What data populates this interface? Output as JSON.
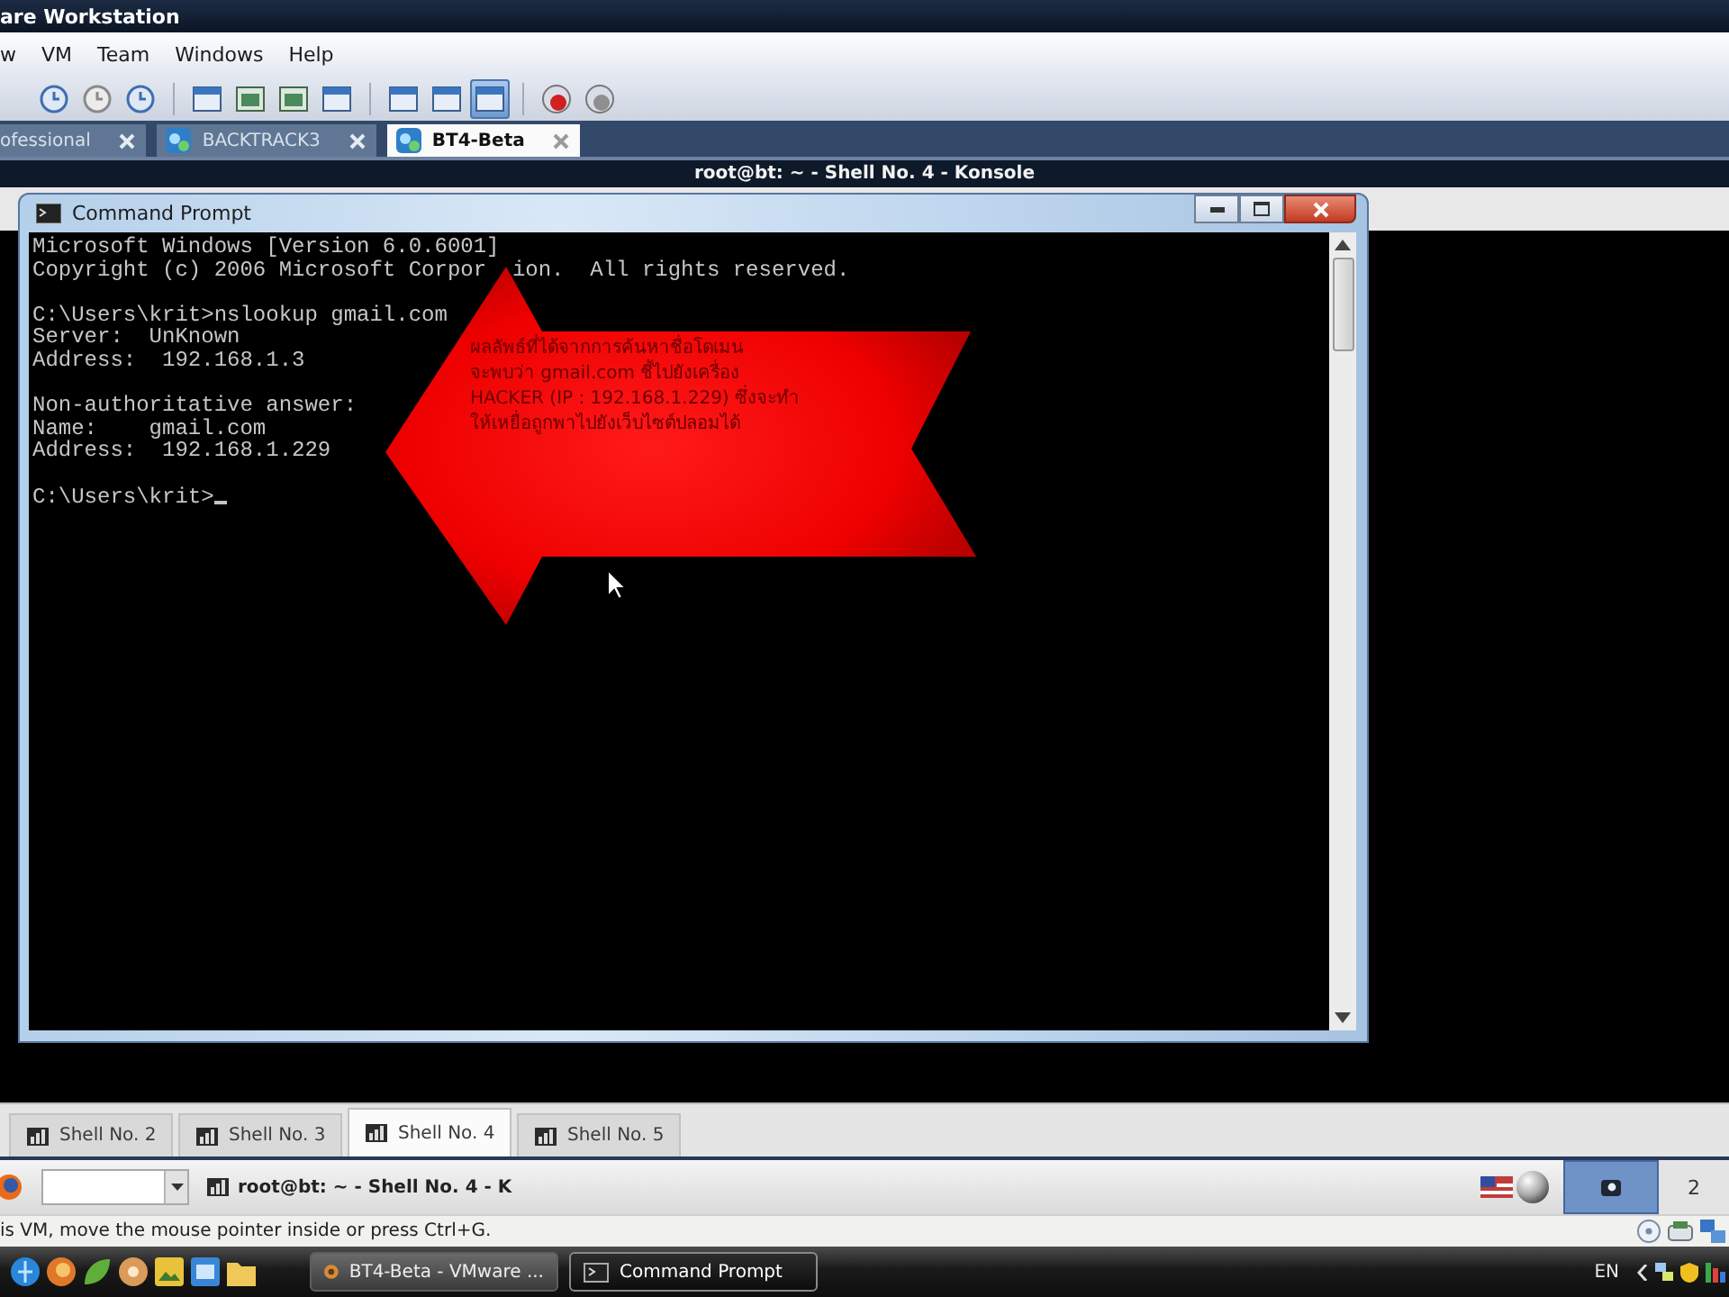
{
  "vmware": {
    "title": "are Workstation",
    "menu": [
      "w",
      "VM",
      "Team",
      "Windows",
      "Help"
    ],
    "toolbar": [
      {
        "buttons": [
          {
            "selected": false
          },
          {
            "selected": false
          },
          {
            "selected": false
          }
        ]
      },
      {
        "buttons": [
          {
            "selected": false
          },
          {
            "selected": false
          },
          {
            "selected": false
          },
          {
            "selected": false
          }
        ]
      },
      {
        "buttons": [
          {
            "selected": false
          },
          {
            "selected": false
          },
          {
            "selected": true
          }
        ]
      },
      {
        "buttons": [
          {
            "selected": false
          },
          {
            "selected": false
          }
        ]
      }
    ],
    "tabs": [
      {
        "label": "ofessional",
        "selected": false
      },
      {
        "label": "BACKTRACK3",
        "selected": false
      },
      {
        "label": "BT4-Beta",
        "selected": true
      }
    ],
    "status_message": "is VM, move the mouse pointer inside or press Ctrl+G."
  },
  "konsole": {
    "title": "root@bt: ~ - Shell No. 4 - Konsole",
    "tabs": [
      {
        "label": "Shell No. 2",
        "selected": false
      },
      {
        "label": "Shell No. 3",
        "selected": false
      },
      {
        "label": "Shell No. 4",
        "selected": true
      },
      {
        "label": "Shell No. 5",
        "selected": false
      }
    ]
  },
  "command_prompt": {
    "title": "Command Prompt",
    "blocks": [
      {
        "kind": "output",
        "lines": [
          [
            "Microsoft Windows [Version 6.0.6001]"
          ],
          [
            "Copyright (c) 2006 Microsoft Corpor",
            "ion.  All rights reserved."
          ]
        ]
      },
      {
        "kind": "output",
        "lines": [
          [
            "C:\\Users\\krit>nslookup gmail.com"
          ],
          [
            "Server:  UnKnown"
          ],
          [
            "Address:  192.168.1.3"
          ]
        ]
      },
      {
        "kind": "output",
        "lines": [
          [
            "Non-authoritative answer:"
          ],
          [
            "Name:    gmail.com"
          ],
          [
            "Address:  192.168.1.229"
          ]
        ]
      },
      {
        "kind": "prompt",
        "lines": [
          [
            "C:\\Users\\krit>"
          ]
        ],
        "cursor": true
      }
    ],
    "annotation": {
      "lines": [
        "ผลลัพธ์ที่ได้จากการค้นหาชื่อโดเมน",
        "จะพบว่า gmail.com ชี้ไปยังเครื่อง",
        "HACKER (IP : 192.168.1.229) ซึ่งจะทำ",
        "ให้เหยื่อถูกพาไปยังเว็บไซต์ปลอมได้"
      ]
    }
  },
  "kde_panel": {
    "task": "root@bt: ~ - Shell No. 4 - K",
    "desktops": [
      {
        "kind": "preview",
        "selected": true
      },
      {
        "kind": "number",
        "label": "2",
        "selected": false
      }
    ]
  },
  "taskbar": {
    "buttons": [
      {
        "label": "BT4-Beta - VMware ...",
        "selected": false
      },
      {
        "label": "Command Prompt",
        "selected": true
      }
    ],
    "language": "EN"
  }
}
